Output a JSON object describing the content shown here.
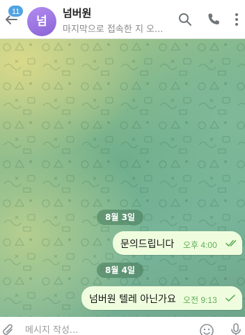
{
  "header": {
    "unread_count": "11",
    "avatar_initial": "넘",
    "title": "넘버원",
    "subtitle": "마지막으로 접속한 지 오..."
  },
  "icons": {
    "back": "arrow-left-icon",
    "search": "search-icon",
    "call": "phone-icon",
    "menu": "more-vertical-icon",
    "attach": "paperclip-icon",
    "emoji": "smile-icon",
    "mic": "microphone-icon",
    "read_status": "double-check-icon",
    "sent_status": "check-icon"
  },
  "colors": {
    "accent": "#4fa3e3",
    "bubble_out": "#effdde",
    "time_green": "#5fae59",
    "avatar": "#9a73e0"
  },
  "messages": [
    {
      "date": "8월 3일",
      "text": "문의드립니다",
      "time": "오후 4:00",
      "status": "read"
    },
    {
      "date": "8월 4일",
      "text": "넘버원 텔레 아닌가요",
      "time": "오전 9:13",
      "status": "sent"
    }
  ],
  "composer": {
    "placeholder": "메시지 작성..."
  }
}
